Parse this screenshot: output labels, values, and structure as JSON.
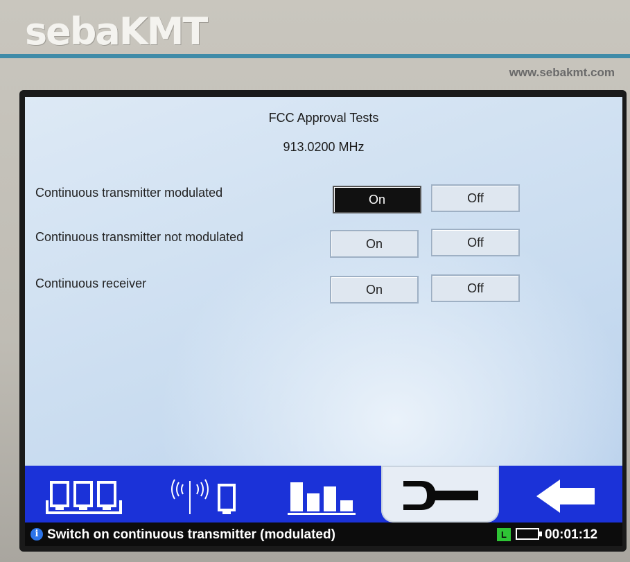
{
  "device": {
    "brand": "sebaKMT",
    "url": "www.sebakmt.com"
  },
  "header": {
    "title": "FCC Approval Tests",
    "frequency": "913.0200 MHz"
  },
  "settings": [
    {
      "label": "Continuous transmitter modulated",
      "on_label": "On",
      "off_label": "Off",
      "state": "On"
    },
    {
      "label": "Continuous transmitter not modulated",
      "on_label": "On",
      "off_label": "Off",
      "state": "Off"
    },
    {
      "label": "Continuous receiver",
      "on_label": "On",
      "off_label": "Off",
      "state": "Off"
    }
  ],
  "toolbar": {
    "items": [
      {
        "icon": "devices-icon"
      },
      {
        "icon": "wireless-icon"
      },
      {
        "icon": "bar-graph-icon"
      },
      {
        "icon": "wrench-icon",
        "selected": true
      },
      {
        "icon": "back-arrow-icon"
      }
    ]
  },
  "status": {
    "message": "Switch on continuous transmitter (modulated)",
    "mode_badge": "L",
    "time": "00:01:12"
  },
  "colors": {
    "toolbar": "#1b32d8",
    "active_button": "#111111",
    "mode_badge": "#2ec435",
    "info_icon": "#2c74e8"
  }
}
